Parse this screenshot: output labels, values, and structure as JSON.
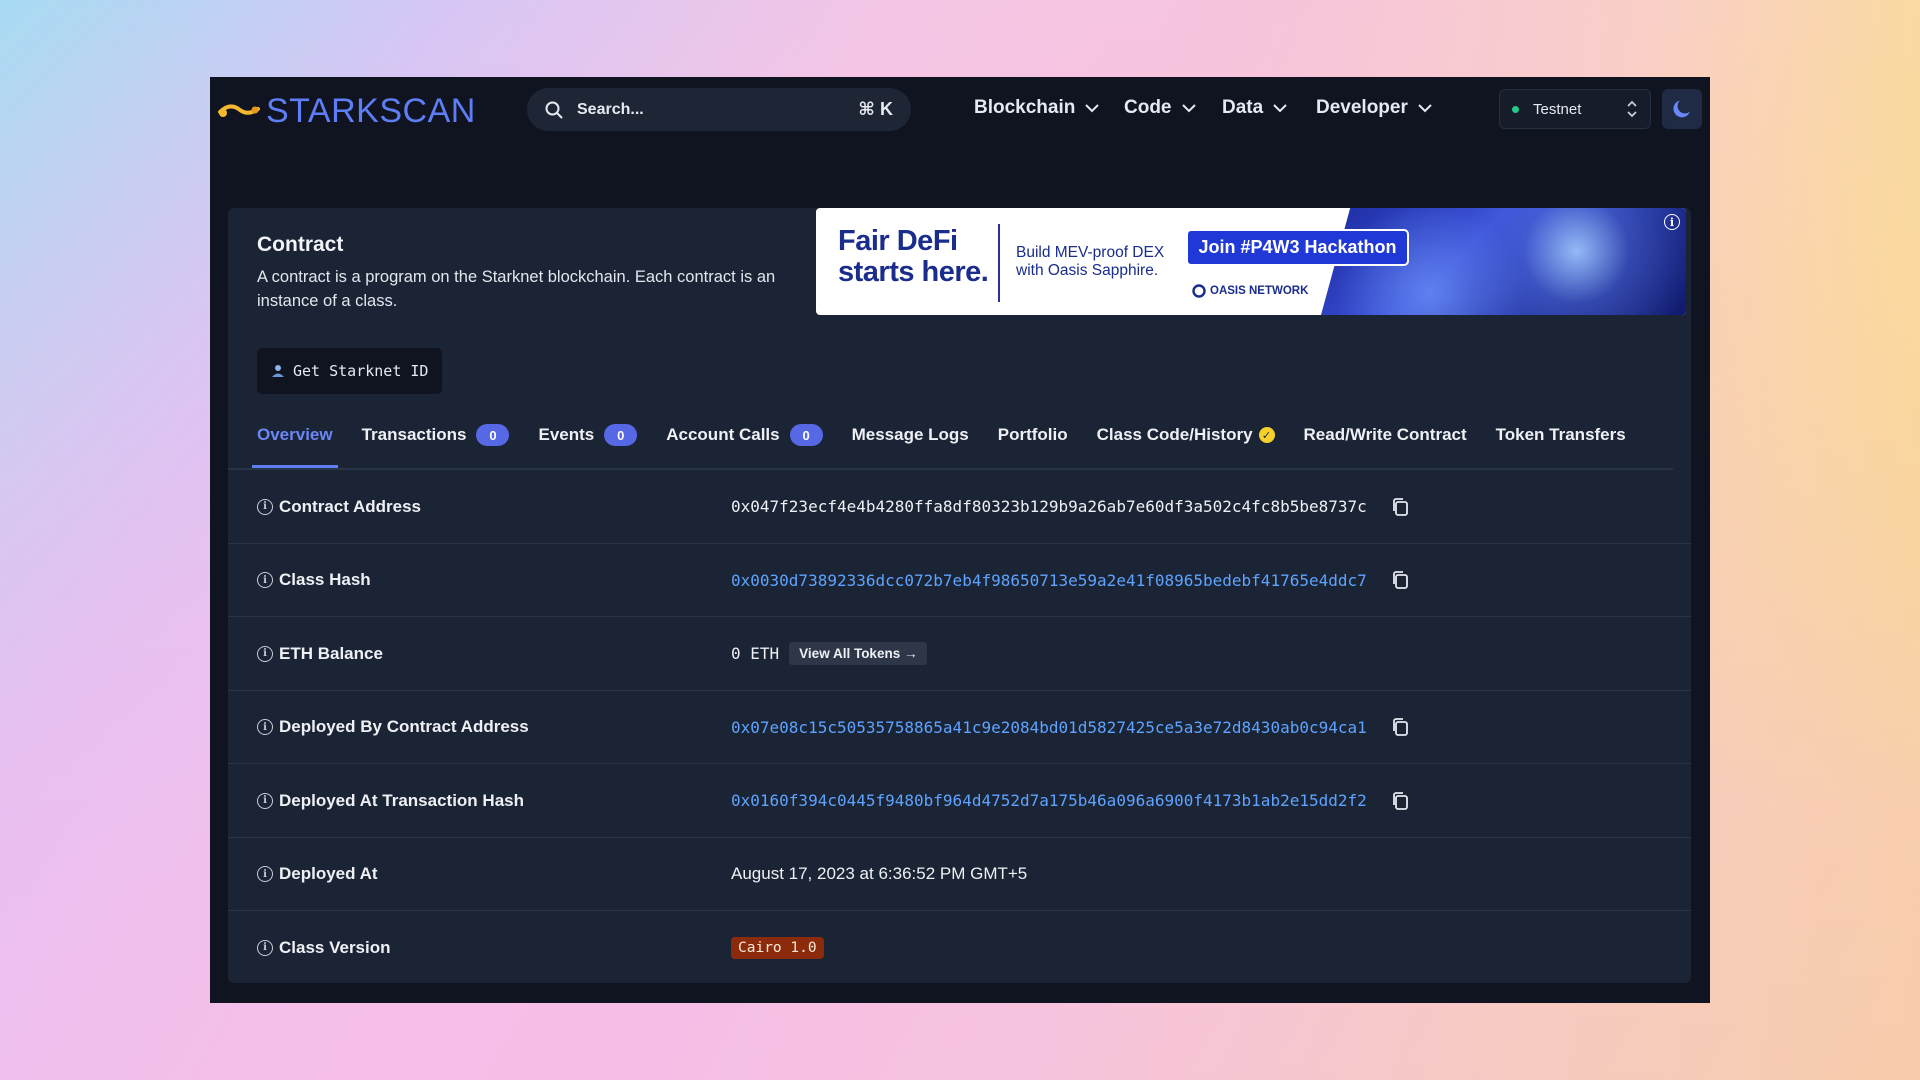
{
  "brand": {
    "name": "STARKSCAN",
    "accent": "#5f7df5"
  },
  "search": {
    "placeholder": "Search...",
    "shortcut": "⌘ K"
  },
  "nav": {
    "items": [
      {
        "label": "Blockchain"
      },
      {
        "label": "Code"
      },
      {
        "label": "Data"
      },
      {
        "label": "Developer"
      }
    ],
    "network": "Testnet"
  },
  "contract": {
    "title": "Contract",
    "description": "A contract is a program on the Starknet blockchain. Each contract is an instance of a class.",
    "starknet_id_button": "Get Starknet ID"
  },
  "ad": {
    "headline_line1": "Fair DeFi",
    "headline_line2": "starts here.",
    "sub_line1": "Build MEV-proof DEX",
    "sub_line2": "with Oasis Sapphire.",
    "cta": "Join #P4W3 Hackathon",
    "brand": "OASIS NETWORK"
  },
  "tabs": [
    {
      "label": "Overview",
      "active": true
    },
    {
      "label": "Transactions",
      "count": "0"
    },
    {
      "label": "Events",
      "count": "0"
    },
    {
      "label": "Account Calls",
      "count": "0"
    },
    {
      "label": "Message Logs"
    },
    {
      "label": "Portfolio"
    },
    {
      "label": "Class Code/History",
      "verified": true
    },
    {
      "label": "Read/Write Contract"
    },
    {
      "label": "Token Transfers"
    }
  ],
  "rows": {
    "contract_address": {
      "label": "Contract Address",
      "value": "0x047f23ecf4e4b4280ffa8df80323b129b9a26ab7e60df3a502c4fc8b5be8737c"
    },
    "class_hash": {
      "label": "Class Hash",
      "value": "0x0030d73892336dcc072b7eb4f98650713e59a2e41f08965bedebf41765e4ddc7"
    },
    "eth_balance": {
      "label": "ETH Balance",
      "value": "0 ETH",
      "button": "View All Tokens →"
    },
    "deployed_by": {
      "label": "Deployed By Contract Address",
      "value": "0x07e08c15c50535758865a41c9e2084bd01d5827425ce5a3e72d8430ab0c94ca1"
    },
    "deployed_tx": {
      "label": "Deployed At Transaction Hash",
      "value": "0x0160f394c0445f9480bf964d4752d7a175b46a096a6900f4173b1ab2e15dd2f2"
    },
    "deployed_at": {
      "label": "Deployed At",
      "value": "August 17, 2023 at 6:36:52 PM GMT+5"
    },
    "class_version": {
      "label": "Class Version",
      "value": "Cairo 1.0"
    }
  },
  "colors": {
    "window_bg": "#0f1420",
    "card_bg": "#1b2434",
    "link": "#5ea3ff",
    "badge": "#5768e6",
    "cairo_badge": "#8c2a0c"
  }
}
